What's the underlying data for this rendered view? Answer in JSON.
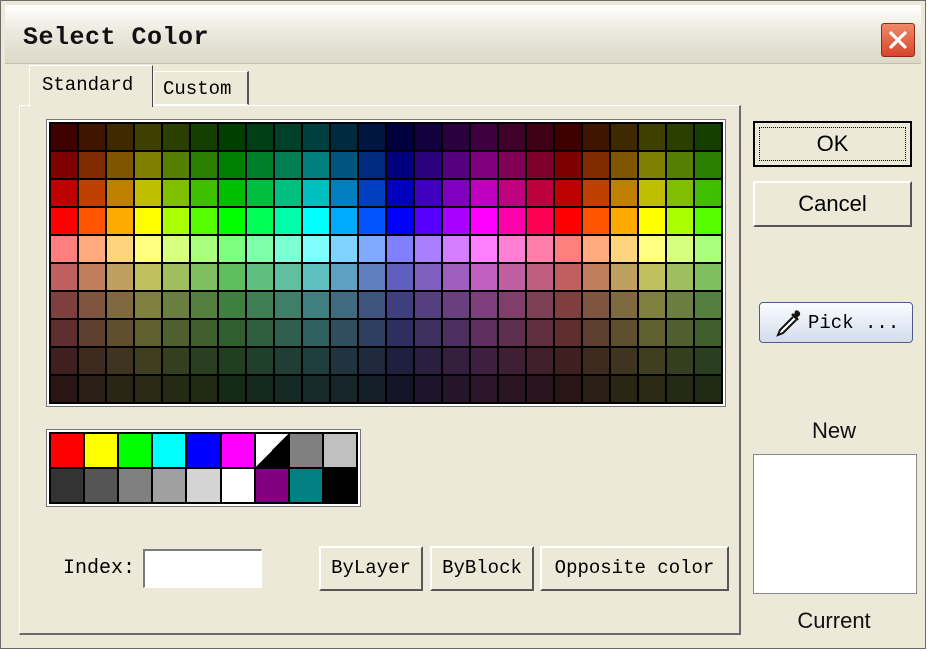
{
  "window": {
    "title": "Select Color"
  },
  "tabs": [
    {
      "label": "Standard",
      "selected": true
    },
    {
      "label": "Custom",
      "selected": false
    }
  ],
  "index": {
    "label": "Index:",
    "value": ""
  },
  "buttons": {
    "bylayer": "ByLayer",
    "byblock": "ByBlock",
    "opposite": "Opposite color",
    "ok": "OK",
    "cancel": "Cancel",
    "pick": "Pick ..."
  },
  "preview": {
    "new_label": "New",
    "current_label": "Current"
  },
  "palette": {
    "columns": 24,
    "rows": [
      [
        "#3f0000",
        "#3f1500",
        "#3f2a00",
        "#3f3f00",
        "#2a3f00",
        "#153f00",
        "#003f00",
        "#003f15",
        "#003f2a",
        "#003f3f",
        "#002a3f",
        "#00153f",
        "#00003f",
        "#15003f",
        "#2a003f",
        "#3f003f",
        "#3f002a",
        "#3f0015",
        "#3f0000",
        "#3f1500",
        "#3f2a00",
        "#3f3f00",
        "#2a3f00",
        "#153f00"
      ],
      [
        "#7f0000",
        "#7f2a00",
        "#7f5500",
        "#7f7f00",
        "#557f00",
        "#2a7f00",
        "#007f00",
        "#007f2a",
        "#007f55",
        "#007f7f",
        "#00557f",
        "#002a7f",
        "#00007f",
        "#2a007f",
        "#55007f",
        "#7f007f",
        "#7f0055",
        "#7f002a",
        "#7f0000",
        "#7f2a00",
        "#7f5500",
        "#7f7f00",
        "#557f00",
        "#2a7f00"
      ],
      [
        "#bf0000",
        "#bf3f00",
        "#bf7f00",
        "#bfbf00",
        "#7fbf00",
        "#3fbf00",
        "#00bf00",
        "#00bf3f",
        "#00bf7f",
        "#00bfbf",
        "#007fbf",
        "#003fbf",
        "#0000bf",
        "#3f00bf",
        "#7f00bf",
        "#bf00bf",
        "#bf007f",
        "#bf003f",
        "#bf0000",
        "#bf3f00",
        "#bf7f00",
        "#bfbf00",
        "#7fbf00",
        "#3fbf00"
      ],
      [
        "#ff0000",
        "#ff5500",
        "#ffaa00",
        "#ffff00",
        "#aaff00",
        "#55ff00",
        "#00ff00",
        "#00ff55",
        "#00ffaa",
        "#00ffff",
        "#00aaff",
        "#0055ff",
        "#0000ff",
        "#5500ff",
        "#aa00ff",
        "#ff00ff",
        "#ff00aa",
        "#ff0055",
        "#ff0000",
        "#ff5500",
        "#ffaa00",
        "#ffff00",
        "#aaff00",
        "#55ff00"
      ],
      [
        "#ff7f7f",
        "#ffaa7f",
        "#ffd47f",
        "#ffff7f",
        "#d4ff7f",
        "#aaff7f",
        "#7fff7f",
        "#7fffaa",
        "#7fffd4",
        "#7fffff",
        "#7fd4ff",
        "#7faaff",
        "#7f7fff",
        "#aa7fff",
        "#d47fff",
        "#ff7fff",
        "#ff7fd4",
        "#ff7faa",
        "#ff7f7f",
        "#ffaa7f",
        "#ffd47f",
        "#ffff7f",
        "#d4ff7f",
        "#aaff7f"
      ],
      [
        "#bf5f5f",
        "#bf7f5f",
        "#bf9f5f",
        "#bfbf5f",
        "#9fbf5f",
        "#7fbf5f",
        "#5fbf5f",
        "#5fbf7f",
        "#5fbf9f",
        "#5fbfbf",
        "#5f9fbf",
        "#5f7fbf",
        "#5f5fbf",
        "#7f5fbf",
        "#9f5fbf",
        "#bf5fbf",
        "#bf5f9f",
        "#bf5f7f",
        "#bf5f5f",
        "#bf7f5f",
        "#bf9f5f",
        "#bfbf5f",
        "#9fbf5f",
        "#7fbf5f"
      ],
      [
        "#7f3f3f",
        "#7f553f",
        "#7f6a3f",
        "#7f7f3f",
        "#6a7f3f",
        "#557f3f",
        "#3f7f3f",
        "#3f7f55",
        "#3f7f6a",
        "#3f7f7f",
        "#3f6a7f",
        "#3f557f",
        "#3f3f7f",
        "#553f7f",
        "#6a3f7f",
        "#7f3f7f",
        "#7f3f6a",
        "#7f3f55",
        "#7f3f3f",
        "#7f553f",
        "#7f6a3f",
        "#7f7f3f",
        "#6a7f3f",
        "#557f3f"
      ],
      [
        "#5f2f2f",
        "#5f3f2f",
        "#5f4f2f",
        "#5f5f2f",
        "#4f5f2f",
        "#3f5f2f",
        "#2f5f2f",
        "#2f5f3f",
        "#2f5f4f",
        "#2f5f5f",
        "#2f4f5f",
        "#2f3f5f",
        "#2f2f5f",
        "#3f2f5f",
        "#4f2f5f",
        "#5f2f5f",
        "#5f2f4f",
        "#5f2f3f",
        "#5f2f2f",
        "#5f3f2f",
        "#5f4f2f",
        "#5f5f2f",
        "#4f5f2f",
        "#3f5f2f"
      ],
      [
        "#3f1f1f",
        "#3f2a1f",
        "#3f341f",
        "#3f3f1f",
        "#343f1f",
        "#2a3f1f",
        "#1f3f1f",
        "#1f3f2a",
        "#1f3f34",
        "#1f3f3f",
        "#1f343f",
        "#1f2a3f",
        "#1f1f3f",
        "#2a1f3f",
        "#341f3f",
        "#3f1f3f",
        "#3f1f34",
        "#3f1f2a",
        "#3f1f1f",
        "#3f2a1f",
        "#3f341f",
        "#3f3f1f",
        "#343f1f",
        "#2a3f1f"
      ],
      [
        "#2a1515",
        "#2a1f15",
        "#2a2515",
        "#2a2a15",
        "#252a15",
        "#1f2a15",
        "#152a15",
        "#152a1f",
        "#152a25",
        "#152a2a",
        "#15252a",
        "#151f2a",
        "#15152a",
        "#1f152a",
        "#25152a",
        "#2a152a",
        "#2a1525",
        "#2a151f",
        "#2a1515",
        "#2a1f15",
        "#2a2515",
        "#2a2a15",
        "#252a15",
        "#1f2a15"
      ]
    ]
  },
  "basic_colors": {
    "row1": [
      "#ff0000",
      "#ffff00",
      "#00ff00",
      "#00ffff",
      "#0000ff",
      "#ff00ff",
      "white/black",
      "#808080",
      "#c0c0c0"
    ],
    "row2": [
      "#333333",
      "#555555",
      "#808080",
      "#a0a0a0",
      "#d4d4d4",
      "#ffffff",
      "#800080",
      "#008080",
      "#000000"
    ]
  },
  "colors": {
    "dialog_bg": "#ece9d8",
    "close_button": "#d6452a"
  },
  "icons": {
    "close": "close-icon",
    "pick": "eyedropper-icon"
  }
}
